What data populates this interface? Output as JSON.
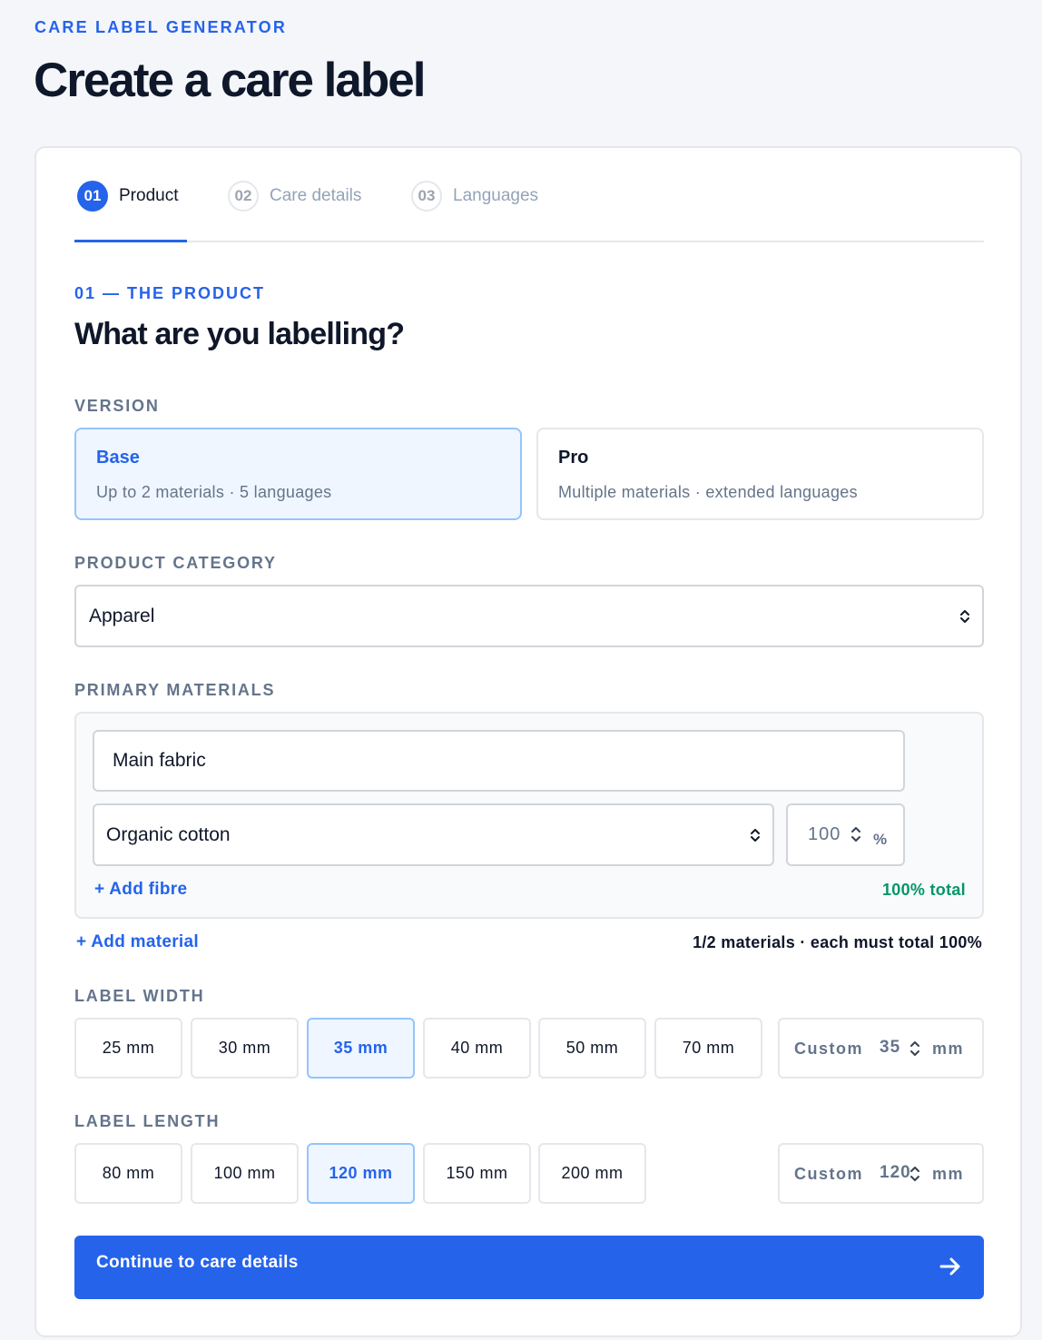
{
  "app": {
    "eyebrow": "CARE LABEL GENERATOR",
    "title": "Create a care label"
  },
  "stepper": {
    "steps": [
      {
        "num": "01",
        "label": "Product",
        "active": true
      },
      {
        "num": "02",
        "label": "Care details",
        "active": false
      },
      {
        "num": "03",
        "label": "Languages",
        "active": false
      }
    ]
  },
  "section": {
    "eyebrow": "01 — THE PRODUCT",
    "title": "What are you labelling?"
  },
  "version": {
    "label": "VERSION",
    "options": [
      {
        "name": "Base",
        "desc": "Up to 2 materials · 5 languages",
        "selected": true
      },
      {
        "name": "Pro",
        "desc": "Multiple materials · extended languages",
        "selected": false
      }
    ]
  },
  "category": {
    "label": "PRODUCT CATEGORY",
    "value": "Apparel"
  },
  "materials": {
    "label": "PRIMARY MATERIALS",
    "material_name": "Main fabric",
    "fibre": "Organic cotton",
    "percent": "100",
    "percent_unit": "%",
    "add_fibre": "+ Add fibre",
    "total": "100% total",
    "add_material": "+ Add material",
    "count_note": "1/2 materials · each must total 100%"
  },
  "width": {
    "label": "LABEL WIDTH",
    "options": [
      "25 mm",
      "30 mm",
      "35 mm",
      "40 mm",
      "50 mm",
      "70 mm"
    ],
    "selected": "35 mm",
    "custom_label": "Custom",
    "custom_value": "35",
    "custom_unit": "mm"
  },
  "length": {
    "label": "LABEL LENGTH",
    "options": [
      "80 mm",
      "100 mm",
      "120 mm",
      "150 mm",
      "200 mm"
    ],
    "selected": "120 mm",
    "custom_label": "Custom",
    "custom_value": "120",
    "custom_unit": "mm"
  },
  "continue": {
    "label": "Continue to care details"
  },
  "colors": {
    "accent": "#2563eb",
    "success": "#059669",
    "selected_bg": "#eff6ff"
  }
}
